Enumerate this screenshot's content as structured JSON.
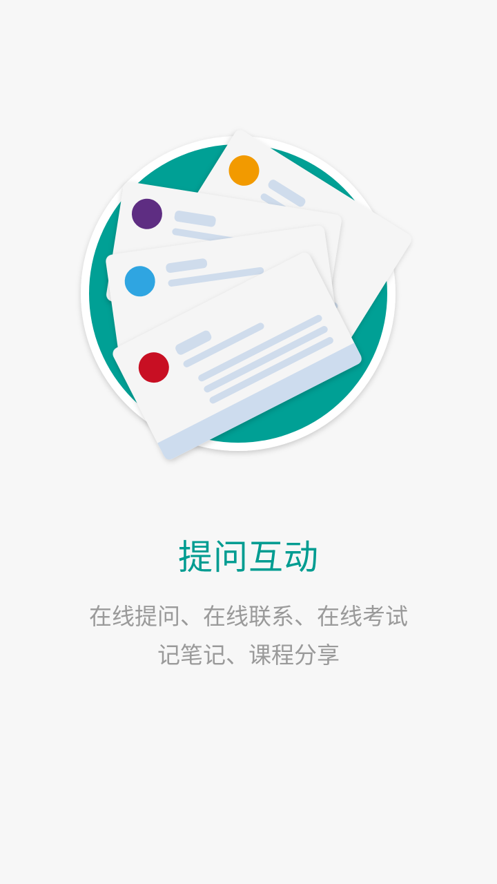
{
  "onboarding": {
    "illustration_icon": "cards-illustration-icon",
    "accent_color": "#009c91",
    "title": "提问互动",
    "description_line1": "在线提问、在线联系、在线考试",
    "description_line2": "记笔记、课程分享"
  }
}
